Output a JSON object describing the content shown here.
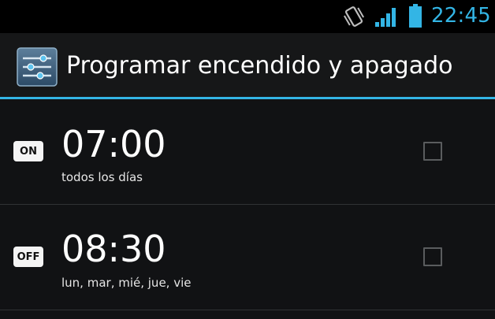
{
  "status_bar": {
    "time": "22:45",
    "icons": [
      "vibrate-icon",
      "signal-icon",
      "battery-icon"
    ],
    "accent_color": "#33b5e5"
  },
  "action_bar": {
    "title": "Programar encendido y apagado",
    "icon": "settings-sliders-icon"
  },
  "schedules": [
    {
      "badge": "ON",
      "time": "07:00",
      "days": "todos los días",
      "checked": false
    },
    {
      "badge": "OFF",
      "time": "08:30",
      "days": "lun, mar, mié, jue, vie",
      "checked": false
    }
  ]
}
